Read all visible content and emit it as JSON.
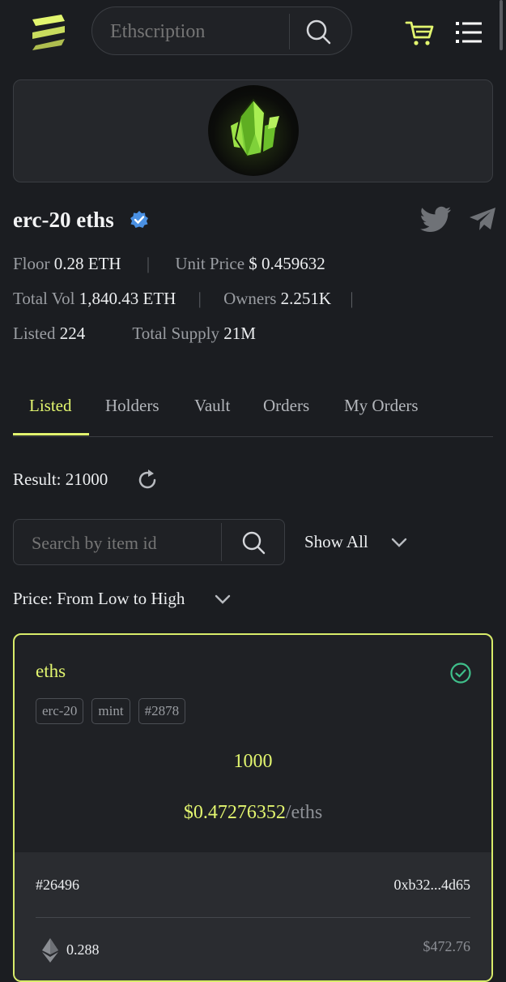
{
  "header": {
    "search_placeholder": "Ethscription"
  },
  "collection": {
    "title": "erc-20 eths",
    "floor_label": "Floor",
    "floor_value": "0.28 ETH",
    "unit_price_label": "Unit Price",
    "unit_price_value": "$ 0.459632",
    "total_vol_label": "Total Vol",
    "total_vol_value": "1,840.43 ETH",
    "owners_label": "Owners",
    "owners_value": "2.251K",
    "listed_label": "Listed",
    "listed_value": "224",
    "supply_label": "Total Supply",
    "supply_value": "21M"
  },
  "tabs": [
    {
      "label": "Listed",
      "active": true
    },
    {
      "label": "Holders"
    },
    {
      "label": "Vault"
    },
    {
      "label": "Orders"
    },
    {
      "label": "My Orders"
    }
  ],
  "filters": {
    "result_label": "Result:",
    "result_value": "21000",
    "search_placeholder": "Search by item id",
    "show_all": "Show All",
    "sort": "Price: From Low to High"
  },
  "card": {
    "name": "eths",
    "tags": [
      "erc-20",
      "mint",
      "#2878"
    ],
    "amount": "1000",
    "unit_price": "$0.47276352",
    "unit": "/eths",
    "item_id": "#26496",
    "owner": "0xb32...4d65",
    "eth_price": "0.288",
    "usd_price": "$472.76"
  },
  "colors": {
    "accent": "#e2f56f",
    "background": "#1b1d21",
    "verified": "#4a90e2",
    "success": "#3fbf8a"
  }
}
